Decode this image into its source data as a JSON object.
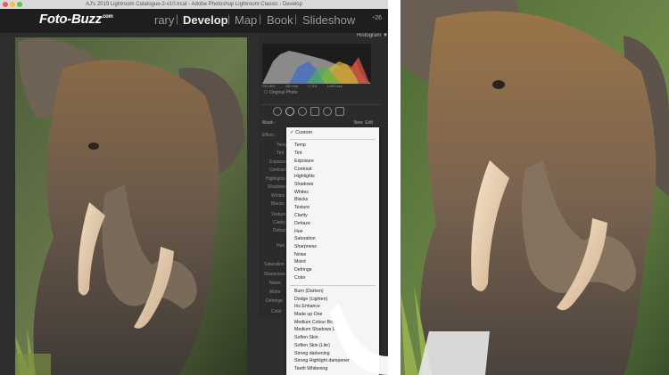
{
  "window": {
    "title": "AJ's 2019 Lightroom Catalogue-2-v10.lrcat - Adobe Photoshop Lightroom Classic - Develop"
  },
  "brand": {
    "logo_text": "Foto-Buzz",
    "logo_suffix": ".com"
  },
  "modules": [
    {
      "label": "Library",
      "visible_text": "rary",
      "active": false
    },
    {
      "label": "Develop",
      "active": true
    },
    {
      "label": "Map",
      "active": false
    },
    {
      "label": "Book",
      "active": false
    },
    {
      "label": "Slideshow",
      "active": false
    }
  ],
  "panel": {
    "histogram_label": "Histogram",
    "histogram_values": [
      "ISO 800",
      "400 mm",
      "f / 5.6",
      "1/400 sec"
    ],
    "original_photo_label": "Original Photo",
    "mask_label": "Mask :",
    "new_label": "New",
    "edit_label": "Edit",
    "effect_label": "Effect :",
    "labels": [
      "Temp",
      "Tint",
      "Exposure",
      "Contrast",
      "Highlights",
      "Shadows",
      "Whites",
      "Blacks",
      "Texture",
      "Clarity",
      "Dehaze",
      "Hue",
      "Saturation",
      "Sharpness",
      "Noise",
      "Moire",
      "Defringe",
      "Color"
    ]
  },
  "dropdown": {
    "selected": "Custom",
    "items_group1": [
      "Temp",
      "Tint",
      "Exposure",
      "Contrast",
      "Highlights",
      "Shadows",
      "Whites",
      "Blacks",
      "Texture",
      "Clarity",
      "Dehaze",
      "Hue",
      "Saturation",
      "Sharpness",
      "Noise",
      "Moiré",
      "Defringe",
      "Color"
    ],
    "items_group2": [
      "Burn (Darken)",
      "Dodge (Lighten)",
      "Iris Enhance",
      "Made up One",
      "Medium Colour Boc IE",
      "Medium Shadows L",
      "Soften Skin",
      "Soften Skin (Lite)",
      "Strong darkening",
      "Strong Highlight dampener",
      "Teeth Whitening"
    ]
  },
  "colors": {
    "module_bar": "#1e1e1e",
    "panel_bg": "#2b2b2b",
    "dropdown_bg": "#f5f5f5",
    "active_module": "#e8e8e8"
  }
}
